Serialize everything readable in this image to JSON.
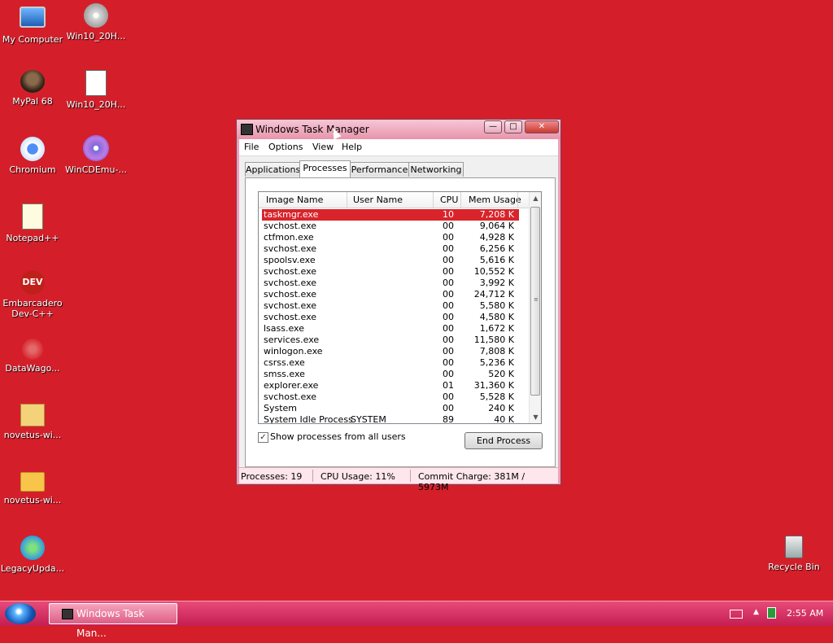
{
  "desktop": {
    "icons": [
      {
        "label": "My Computer"
      },
      {
        "label": "Win10_20H..."
      },
      {
        "label": "MyPal 68"
      },
      {
        "label": "Win10_20H..."
      },
      {
        "label": "Chromium"
      },
      {
        "label": "WinCDEmu-..."
      },
      {
        "label": "Notepad++"
      },
      {
        "label": "Embarcadero Dev-C++"
      },
      {
        "label": "DataWago..."
      },
      {
        "label": "novetus-wi..."
      },
      {
        "label": "novetus-wi..."
      },
      {
        "label": "LegacyUpda..."
      },
      {
        "label": "Recycle Bin"
      }
    ],
    "dev_icon_text": "DEV"
  },
  "window": {
    "title": "Windows Task Manager",
    "menu": [
      "File",
      "Options",
      "View",
      "Help"
    ],
    "tabs": [
      "Applications",
      "Processes",
      "Performance",
      "Networking"
    ],
    "active_tab": "Processes",
    "columns": [
      "Image Name",
      "User Name",
      "CPU",
      "Mem Usage"
    ],
    "processes": [
      {
        "name": "taskmgr.exe",
        "user": "",
        "cpu": "10",
        "mem": "7,208 K",
        "selected": true
      },
      {
        "name": "svchost.exe",
        "user": "",
        "cpu": "00",
        "mem": "9,064 K"
      },
      {
        "name": "ctfmon.exe",
        "user": "",
        "cpu": "00",
        "mem": "4,928 K"
      },
      {
        "name": "svchost.exe",
        "user": "",
        "cpu": "00",
        "mem": "6,256 K"
      },
      {
        "name": "spoolsv.exe",
        "user": "",
        "cpu": "00",
        "mem": "5,616 K"
      },
      {
        "name": "svchost.exe",
        "user": "",
        "cpu": "00",
        "mem": "10,552 K"
      },
      {
        "name": "svchost.exe",
        "user": "",
        "cpu": "00",
        "mem": "3,992 K"
      },
      {
        "name": "svchost.exe",
        "user": "",
        "cpu": "00",
        "mem": "24,712 K"
      },
      {
        "name": "svchost.exe",
        "user": "",
        "cpu": "00",
        "mem": "5,580 K"
      },
      {
        "name": "svchost.exe",
        "user": "",
        "cpu": "00",
        "mem": "4,580 K"
      },
      {
        "name": "lsass.exe",
        "user": "",
        "cpu": "00",
        "mem": "1,672 K"
      },
      {
        "name": "services.exe",
        "user": "",
        "cpu": "00",
        "mem": "11,580 K"
      },
      {
        "name": "winlogon.exe",
        "user": "",
        "cpu": "00",
        "mem": "7,808 K"
      },
      {
        "name": "csrss.exe",
        "user": "",
        "cpu": "00",
        "mem": "5,236 K"
      },
      {
        "name": "smss.exe",
        "user": "",
        "cpu": "00",
        "mem": "520 K"
      },
      {
        "name": "explorer.exe",
        "user": "",
        "cpu": "01",
        "mem": "31,360 K"
      },
      {
        "name": "svchost.exe",
        "user": "",
        "cpu": "00",
        "mem": "5,528 K"
      },
      {
        "name": "System",
        "user": "",
        "cpu": "00",
        "mem": "240 K"
      },
      {
        "name": "System Idle Process",
        "user": "SYSTEM",
        "cpu": "89",
        "mem": "40 K"
      }
    ],
    "show_all_users_label": "Show processes from all users",
    "show_all_users_checked": true,
    "end_process_label": "End Process",
    "status": {
      "processes": "Processes: 19",
      "cpu": "CPU Usage: 11%",
      "commit": "Commit Charge: 381M / 5973M"
    }
  },
  "taskbar": {
    "task_label": "Windows Task Man...",
    "time": "2:55 AM"
  },
  "colors": {
    "desktop": "#d41f2a",
    "selection": "#d9242b",
    "taskbar": "#d53a68"
  }
}
